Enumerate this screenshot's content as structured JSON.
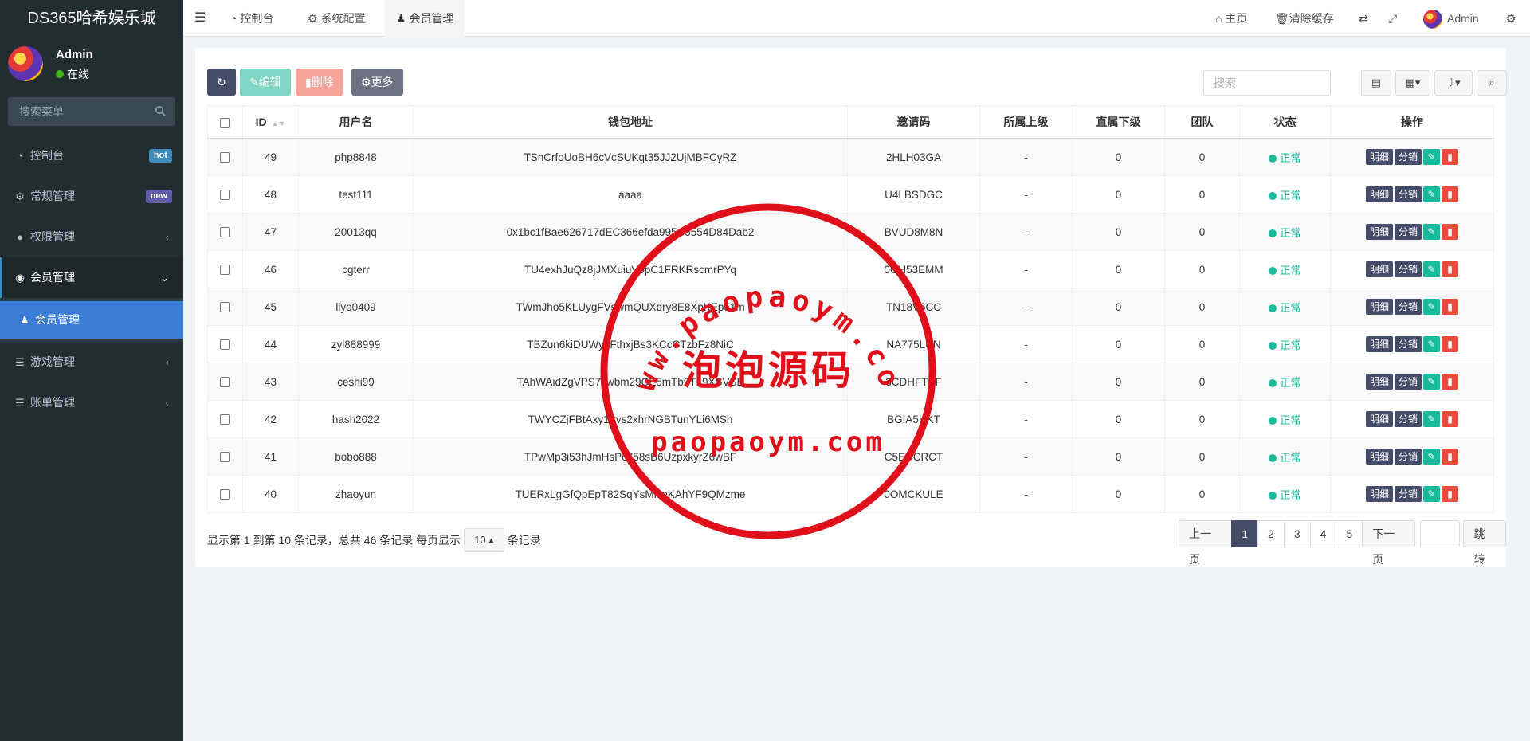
{
  "sidebar": {
    "brand": "DS365哈希娱乐城",
    "user_name": "Admin",
    "user_status": "在线",
    "search_placeholder": "搜索菜单",
    "items": [
      {
        "label": "控制台",
        "icon": "dashboard-icon",
        "badge": "hot",
        "badge_color": "#3c8dbc"
      },
      {
        "label": "常规管理",
        "icon": "cogs-icon",
        "badge": "new",
        "badge_color": "#605ca8"
      },
      {
        "label": "权限管理",
        "icon": "group-icon"
      },
      {
        "label": "会员管理",
        "icon": "user-circle-icon"
      },
      {
        "label": "会员管理",
        "icon": "user-icon"
      },
      {
        "label": "游戏管理",
        "icon": "list-icon"
      },
      {
        "label": "账单管理",
        "icon": "list-icon"
      }
    ]
  },
  "topbar": {
    "tabs": [
      {
        "label": "控制台",
        "icon": "dashboard-icon"
      },
      {
        "label": "系统配置",
        "icon": "gear-icon"
      },
      {
        "label": "会员管理",
        "icon": "user-icon"
      }
    ],
    "home_label": "主页",
    "clear_cache_label": "清除缓存",
    "user_label": "Admin"
  },
  "toolbar": {
    "edit_label": "编辑",
    "delete_label": "删除",
    "more_label": "更多",
    "search_placeholder": "搜索"
  },
  "table": {
    "headers": [
      "ID",
      "用户名",
      "钱包地址",
      "邀请码",
      "所属上级",
      "直属下级",
      "团队",
      "状态",
      "操作"
    ],
    "rows": [
      {
        "id": "49",
        "username": "php8848",
        "wallet": "TSnCrfoUoBH6cVcSUKqt35JJ2UjMBFCyRZ",
        "invite": "2HLH03GA",
        "parent": "-",
        "direct": "0",
        "team": "0",
        "status": "正常"
      },
      {
        "id": "48",
        "username": "test111",
        "wallet": "aaaa",
        "invite": "U4LBSDGC",
        "parent": "-",
        "direct": "0",
        "team": "0",
        "status": "正常"
      },
      {
        "id": "47",
        "username": "20013qq",
        "wallet": "0x1bc1fBae626717dEC366efda995C5554D84Dab2",
        "invite": "BVUD8M8N",
        "parent": "-",
        "direct": "0",
        "team": "0",
        "status": "正常"
      },
      {
        "id": "46",
        "username": "cgterr",
        "wallet": "TU4exhJuQz8jJMXuiuV6pC1FRKRscmrPYq",
        "invite": "0GH53EMM",
        "parent": "-",
        "direct": "0",
        "team": "0",
        "status": "正常"
      },
      {
        "id": "45",
        "username": "liyo0409",
        "wallet": "TWmJho5KLUygFVswmQUXdry8E8XpKEp51m",
        "invite": "TN18V6CC",
        "parent": "-",
        "direct": "0",
        "team": "0",
        "status": "正常"
      },
      {
        "id": "44",
        "username": "zyl888999",
        "wallet": "TBZun6kiDUWy3FthxjBs3KCcCTzbFz8NiC",
        "invite": "NA775LUN",
        "parent": "-",
        "direct": "0",
        "team": "0",
        "status": "正常"
      },
      {
        "id": "43",
        "username": "ceshi99",
        "wallet": "TAhWAidZgVPS7swbm29CE5mTb9TL9XSVSB",
        "invite": "3CDHFTEF",
        "parent": "-",
        "direct": "0",
        "team": "0",
        "status": "正常"
      },
      {
        "id": "42",
        "username": "hash2022",
        "wallet": "TWYCZjFBtAxy1rtvs2xhrNGBTunYLi6MSh",
        "invite": "BGIA5HKT",
        "parent": "-",
        "direct": "0",
        "team": "0",
        "status": "正常"
      },
      {
        "id": "41",
        "username": "bobo888",
        "wallet": "TPwMp3i53hJmHsPc758sB6UzpxkyrZ6wBF",
        "invite": "C5EDCRCT",
        "parent": "-",
        "direct": "0",
        "team": "0",
        "status": "正常"
      },
      {
        "id": "40",
        "username": "zhaoyun",
        "wallet": "TUERxLgGfQpEpT82SqYsMReKAhYF9QMzme",
        "invite": "0OMCKULE",
        "parent": "-",
        "direct": "0",
        "team": "0",
        "status": "正常"
      }
    ],
    "action_detail": "明细",
    "action_commission": "分销"
  },
  "pager": {
    "info_prefix": "显示第 1 到第 10 条记录，总共 46 条记录 每页显示",
    "page_size": "10",
    "info_suffix": "条记录",
    "prev": "上一页",
    "pages": [
      "1",
      "2",
      "3",
      "4",
      "5"
    ],
    "next": "下一页",
    "jump": "跳转"
  },
  "watermark": {
    "arc_text": "www.paopaoym.com",
    "center_text": "泡泡源码",
    "bottom_text": "paopaoym.com",
    "color": "#e0101a"
  }
}
